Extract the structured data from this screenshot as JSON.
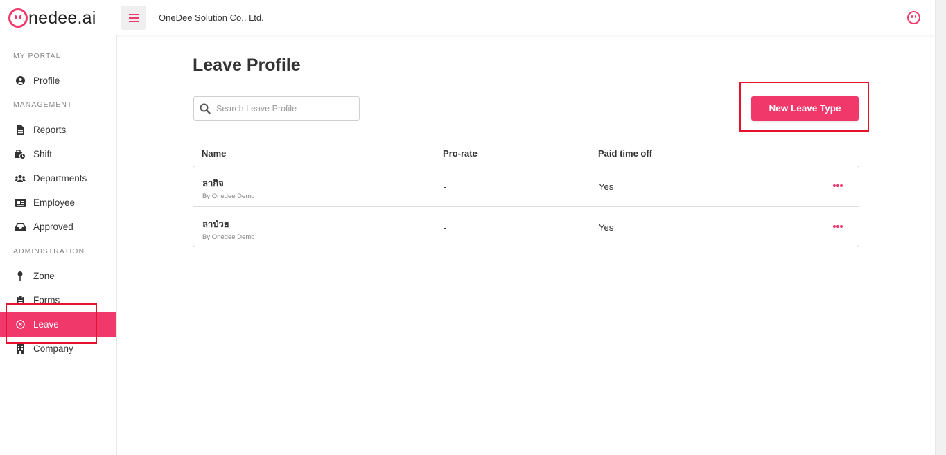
{
  "header": {
    "logo_text": "nedee.ai",
    "company_name": "OneDee Solution Co., Ltd."
  },
  "sidebar": {
    "sections": [
      {
        "label": "MY PORTAL"
      },
      {
        "label": "MANAGEMENT"
      },
      {
        "label": "ADMINISTRATION"
      }
    ],
    "items": [
      {
        "label": "Profile",
        "icon": "user-circle-icon"
      },
      {
        "label": "Reports",
        "icon": "document-icon"
      },
      {
        "label": "Shift",
        "icon": "shift-clock-icon"
      },
      {
        "label": "Departments",
        "icon": "users-icon"
      },
      {
        "label": "Employee",
        "icon": "id-card-icon"
      },
      {
        "label": "Approved",
        "icon": "inbox-icon"
      },
      {
        "label": "Zone",
        "icon": "map-pin-icon"
      },
      {
        "label": "Forms",
        "icon": "clipboard-icon"
      },
      {
        "label": "Leave",
        "icon": "circle-x-icon",
        "active": true
      },
      {
        "label": "Company",
        "icon": "building-icon"
      }
    ]
  },
  "main": {
    "title": "Leave Profile",
    "search_placeholder": "Search Leave Profile",
    "new_button_label": "New Leave Type",
    "columns": [
      "Name",
      "Pro-rate",
      "Paid time off"
    ],
    "rows": [
      {
        "name": "ลากิจ",
        "by": "By Onedee Demo",
        "prorate": "-",
        "paid": "Yes"
      },
      {
        "name": "ลาป่วย",
        "by": "By Onedee Demo",
        "prorate": "-",
        "paid": "Yes"
      }
    ]
  },
  "colors": {
    "accent": "#f0386b",
    "highlight_box": "#e8112d"
  }
}
